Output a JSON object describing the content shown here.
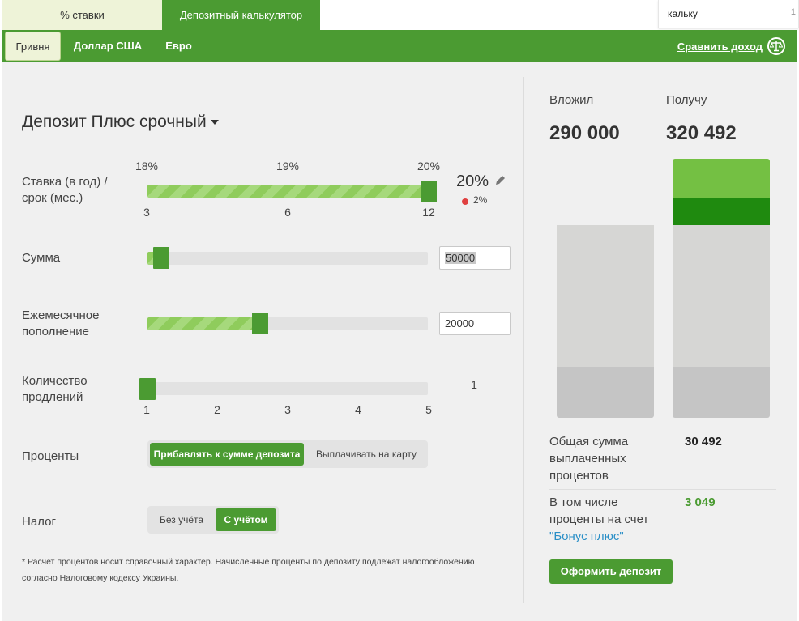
{
  "tabs": {
    "rates": "% ставки",
    "calculator": "Депозитный калькулятор"
  },
  "search": {
    "value": "кальку",
    "suffix": "1"
  },
  "currencies": {
    "uah": "Гривня",
    "usd": "Доллар США",
    "eur": "Евро"
  },
  "compare_label": "Сравнить доход",
  "product": "Депозит Плюс срочный",
  "rate": {
    "label_line1": "Ставка (в год) /",
    "label_line2": "срок (мес.)",
    "top_ticks": [
      "18%",
      "19%",
      "20%"
    ],
    "bottom_ticks": [
      "3",
      "6",
      "12"
    ],
    "value": "20%",
    "bonus": "2%",
    "slider_fraction": 1.0
  },
  "amount": {
    "label": "Сумма",
    "value": "50000",
    "slider_fraction": 0.05
  },
  "monthly": {
    "label_line1": "Ежемесячное",
    "label_line2": "пополнение",
    "value": "20000",
    "slider_fraction": 0.4
  },
  "renewals": {
    "label_line1": "Количество",
    "label_line2": "продлений",
    "ticks": [
      "1",
      "2",
      "3",
      "4",
      "5"
    ],
    "value": "1",
    "slider_fraction": 0.0
  },
  "interest": {
    "label": "Проценты",
    "opt_add": "Прибавлять к сумме депозита",
    "opt_card": "Выплачивать на карту",
    "selected": "add"
  },
  "tax": {
    "label": "Налог",
    "opt_without": "Без учёта",
    "opt_with": "С учётом",
    "selected": "with"
  },
  "note_line1": "* Расчет процентов носит справочный характер. Начисленные проценты по депозиту подлежат налогообложению",
  "note_line2": "согласно Налоговому кодексу Украины.",
  "result": {
    "invested_label": "Вложил",
    "invested_value": "290 000",
    "receive_label": "Получу",
    "receive_value": "320 492",
    "total_interest_line1": "Общая сумма",
    "total_interest_line2": "выплаченных",
    "total_interest_line3": "процентов",
    "total_interest_value": "30 492",
    "bonus_line1": "В том числе",
    "bonus_line2": "проценты на счет",
    "bonus_link": "\"Бонус плюс\"",
    "bonus_value": "3 049",
    "apply_button": "Оформить депозит"
  },
  "colors": {
    "brand_green": "#4b9b32",
    "light_green": "#74c043",
    "dark_green": "#1f8a0f",
    "bar_light_gray": "#d6d6d4",
    "bar_gray": "#c5c5c5"
  }
}
